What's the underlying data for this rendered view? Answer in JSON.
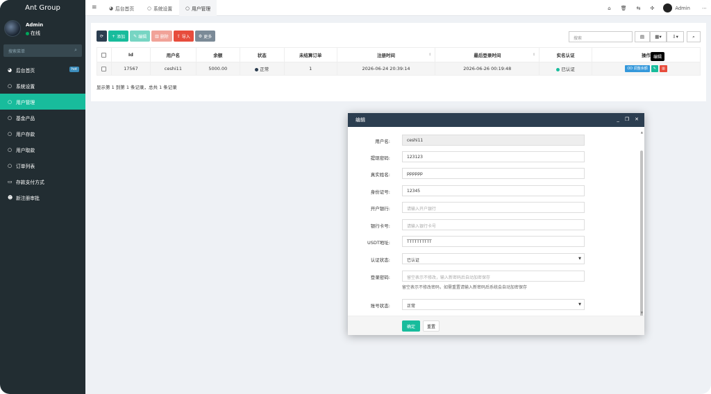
{
  "app": {
    "brand": "Ant Group"
  },
  "user": {
    "name": "Admin",
    "status": "在线"
  },
  "sidebar": {
    "search_placeholder": "搜索菜单",
    "badge": "hot",
    "items": [
      {
        "label": "后台首页",
        "icon": "dashboard-icon"
      },
      {
        "label": "系统设置",
        "icon": "circle-icon"
      },
      {
        "label": "用户管理",
        "icon": "circle-icon"
      },
      {
        "label": "基金产品",
        "icon": "circle-icon"
      },
      {
        "label": "用户存款",
        "icon": "circle-icon"
      },
      {
        "label": "用户取款",
        "icon": "circle-icon"
      },
      {
        "label": "订单列表",
        "icon": "circle-icon"
      },
      {
        "label": "存款支付方式",
        "icon": "card-icon"
      },
      {
        "label": "新注册审批",
        "icon": "user-plus-icon"
      }
    ]
  },
  "topbar": {
    "tabs": [
      "后台首页",
      "系统设置",
      "用户管理"
    ],
    "admin": "Admin"
  },
  "toolbar": {
    "add": "添加",
    "edit": "编辑",
    "delete": "删除",
    "import": "导入",
    "more": "更多",
    "search_placeholder": "搜索"
  },
  "table": {
    "headers": [
      "Id",
      "用户名",
      "余额",
      "状态",
      "未结算订单",
      "注册时间",
      "最后登录时间",
      "实名认证",
      "操作"
    ],
    "rows": [
      {
        "id": "17567",
        "username": "ceshi11",
        "balance": "5000.00",
        "status": "正常",
        "pending": "1",
        "reg_time": "2026-06-24 20:39:14",
        "last_login": "2026-06-26 00:19:48",
        "verified": "已认证",
        "op_detail": "OD 调整余额"
      }
    ],
    "tooltip": "编辑",
    "summary": "显示第 1 到第 1 条记录，总共 1 条记录"
  },
  "modal": {
    "title": "编辑",
    "fields": [
      {
        "label": "用户名:",
        "value": "ceshi11"
      },
      {
        "label": "提现密码:",
        "value": "123123"
      },
      {
        "label": "真实姓名:",
        "value": "pppppp"
      },
      {
        "label": "身份证号:",
        "value": "12345"
      },
      {
        "label": "开户银行:",
        "placeholder": "请输入开户银行"
      },
      {
        "label": "银行卡号:",
        "placeholder": "请输入银行卡号"
      },
      {
        "label": "USDT地址:",
        "value": "TTTTTTTTTT"
      },
      {
        "label": "认证状态:",
        "value": "已认证"
      },
      {
        "label": "登录密码:",
        "placeholder": "留空表示不修改，输入新密码后自动加密保存",
        "help": "留空表示不修改密码，如需重置请输入新密码后系统会自动加密保存"
      },
      {
        "label": "账号状态:",
        "value": "正常"
      }
    ],
    "ok": "确定",
    "reset": "重置"
  },
  "colors": {
    "accent": "#18bc9c",
    "sidebar": "#222d32",
    "header": "#2c3e50",
    "danger": "#e74c3c",
    "primary": "#3498db"
  }
}
